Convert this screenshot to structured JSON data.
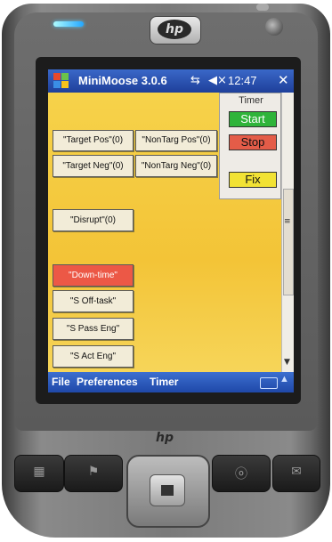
{
  "window": {
    "title": "MiniMoose 3.0.6",
    "time": "12:47",
    "close_label": "✕",
    "signal_icon": "signal-icon",
    "volume_icon": "volume-muted-icon"
  },
  "timer": {
    "label": "Timer",
    "start_label": "Start",
    "stop_label": "Stop",
    "fix_label": "Fix"
  },
  "buttons": {
    "target_pos": "\"Target Pos\"(0)",
    "nontarg_pos": "\"NonTarg Pos\"(0)",
    "target_neg": "\"Target Neg\"(0)",
    "nontarg_neg": "\"NonTarg Neg\"(0)",
    "disrupt": "\"Disrupt\"(0)",
    "down_time": "\"Down-time\"",
    "s_off_task": "\"S Off-task\"",
    "s_pass_eng": "\"S Pass Eng\"",
    "s_act_eng": "\"S Act Eng\""
  },
  "menu": {
    "file": "File",
    "preferences": "Preferences",
    "timer": "Timer"
  },
  "device": {
    "brand": "hp",
    "lower_brand": "hp"
  },
  "colors": {
    "background": "#f3c437",
    "titlebar": "#1e3f9a",
    "start": "#2fb43a",
    "stop": "#e45c48",
    "fix": "#f2e234",
    "down_time": "#ec5846"
  }
}
